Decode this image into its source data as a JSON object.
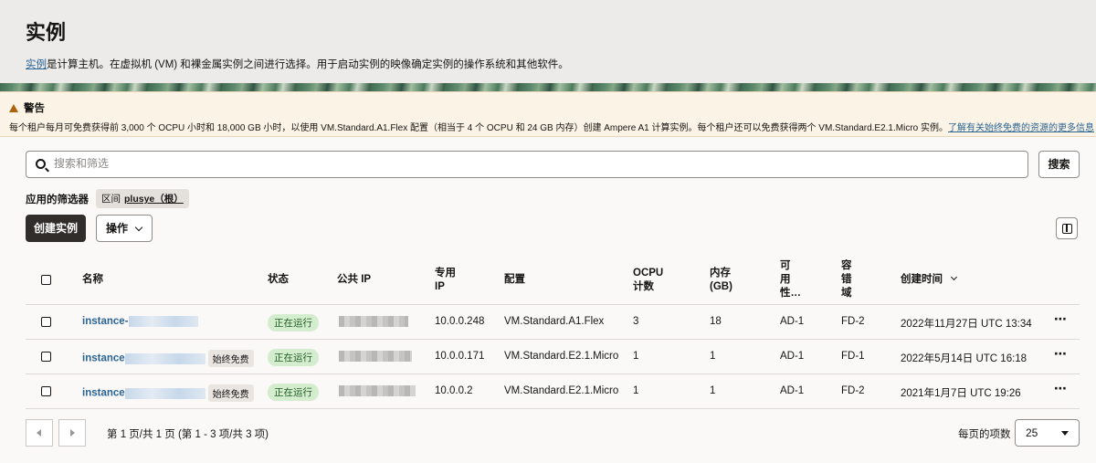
{
  "header": {
    "title": "实例",
    "desc_link": "实例",
    "desc_text": "是计算主机。在虚拟机 (VM) 和裸金属实例之间进行选择。用于启动实例的映像确定实例的操作系统和其他软件。"
  },
  "warning": {
    "title": "警告",
    "text": "每个租户每月可免费获得前 3,000 个 OCPU 小时和 18,000 GB 小时，以使用 VM.Standard.A1.Flex 配置（相当于 4 个 OCPU 和 24 GB 内存）创建 Ampere A1 计算实例。每个租户还可以免费获得两个 VM.Standard.E2.1.Micro 实例。",
    "link": "了解有关始终免费的资源的更多信息"
  },
  "search": {
    "placeholder": "搜索和筛选",
    "button": "搜索"
  },
  "filters": {
    "label": "应用的筛选器",
    "chip_key": "区间",
    "chip_value": "plusye（根）"
  },
  "toolbar": {
    "create": "创建实例",
    "actions": "操作"
  },
  "columns": {
    "name": "名称",
    "status": "状态",
    "public_ip": "公共 IP",
    "private_ip": [
      "专用",
      "IP"
    ],
    "shape": "配置",
    "ocpu": [
      "OCPU",
      "计数"
    ],
    "memory": [
      "内存",
      "(GB)"
    ],
    "ad": [
      "可",
      "用",
      "性…"
    ],
    "fd": [
      "容",
      "错",
      "域"
    ],
    "created": "创建时间"
  },
  "rows": [
    {
      "name": "instance-",
      "badge": "",
      "status": "正在运行",
      "private_ip": "10.0.0.248",
      "shape": "VM.Standard.A1.Flex",
      "ocpu": "3",
      "memory": "18",
      "ad": "AD-1",
      "fd": "FD-2",
      "created": "2022年11月27日 UTC 13:34"
    },
    {
      "name": "instance",
      "badge": "始终免费",
      "status": "正在运行",
      "private_ip": "10.0.0.171",
      "shape": "VM.Standard.E2.1.Micro",
      "ocpu": "1",
      "memory": "1",
      "ad": "AD-1",
      "fd": "FD-1",
      "created": "2022年5月14日 UTC 16:18"
    },
    {
      "name": "instance",
      "badge": "始终免费",
      "status": "正在运行",
      "private_ip": "10.0.0.2",
      "shape": "VM.Standard.E2.1.Micro",
      "ocpu": "1",
      "memory": "1",
      "ad": "AD-1",
      "fd": "FD-2",
      "created": "2021年1月7日 UTC 19:26"
    }
  ],
  "pagination": {
    "text": "第 1 页/共 1 页 (第 1 - 3 项/共 3 项)",
    "per_page_label": "每页的项数",
    "per_page": "25"
  },
  "colors": {
    "link": "#2a6496",
    "primary_button": "#312d2a",
    "status_bg": "#d4edcf",
    "warning_bg": "#fbf3e5"
  }
}
